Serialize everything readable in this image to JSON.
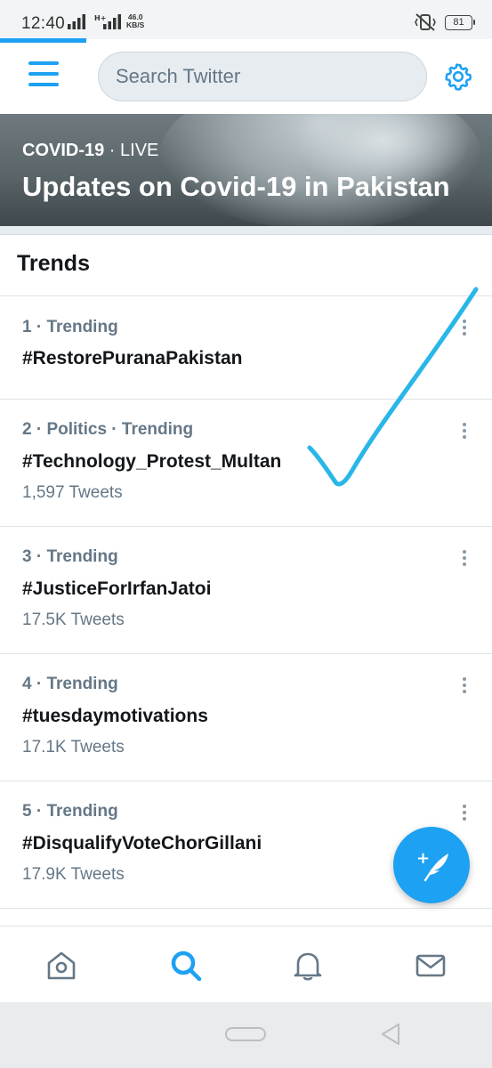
{
  "status_bar": {
    "time": "12:40",
    "speed_value": "46.0",
    "speed_unit": "KB/S",
    "battery": "81"
  },
  "header": {
    "search_placeholder": "Search Twitter",
    "menu_icon": "hamburger-menu-icon",
    "settings_icon": "gear-icon"
  },
  "banner": {
    "category": "COVID-19",
    "separator": " · ",
    "status": "LIVE",
    "title": "Updates on Covid-19 in Pakistan"
  },
  "trends": {
    "heading": "Trends",
    "items": [
      {
        "meta": "1 · Trending",
        "tag": "#RestorePuranaPakistan",
        "count": ""
      },
      {
        "meta": "2 · Politics · Trending",
        "tag": "#Technology_Protest_Multan",
        "count": "1,597 Tweets"
      },
      {
        "meta": "3 · Trending",
        "tag": "#JusticeForIrfanJatoi",
        "count": "17.5K Tweets"
      },
      {
        "meta": "4 · Trending",
        "tag": "#tuesdaymotivations",
        "count": "17.1K Tweets"
      },
      {
        "meta": "5 · Trending",
        "tag": "#DisqualifyVoteChorGillani",
        "count": "17.9K Tweets"
      }
    ]
  },
  "colors": {
    "accent": "#1da1f2",
    "checkmark": "#29b6e8",
    "secondary_text": "#657786"
  },
  "bottom_nav": [
    "home-icon",
    "search-icon",
    "notifications-bell-icon",
    "messages-envelope-icon"
  ],
  "fab_icon": "compose-tweet-icon"
}
